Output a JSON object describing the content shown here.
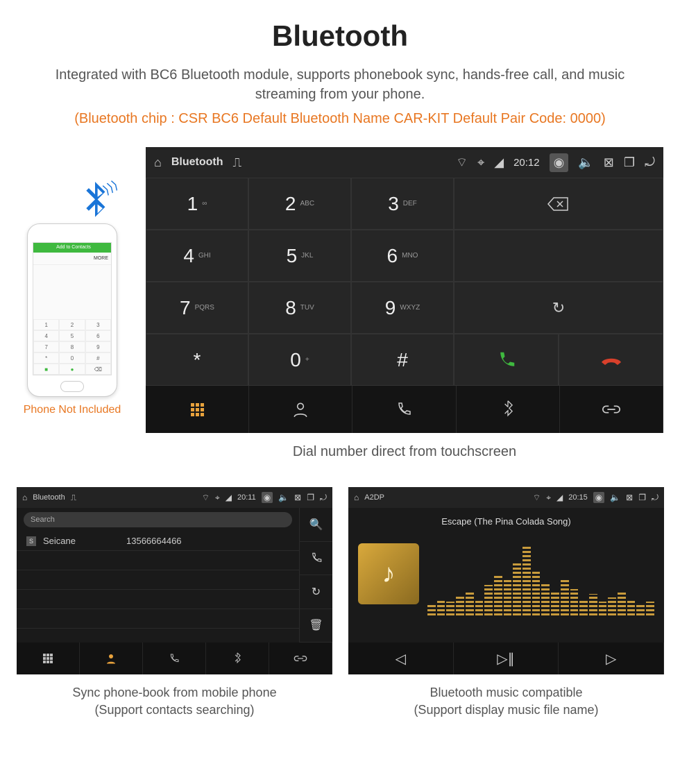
{
  "title": "Bluetooth",
  "subtitle": "Integrated with BC6 Bluetooth module, supports phonebook sync, hands-free call, and music streaming from your phone.",
  "spec": "(Bluetooth chip : CSR BC6     Default Bluetooth Name CAR-KIT     Default Pair Code: 0000)",
  "phone_caption": "Phone Not Included",
  "phone_header": "Add to Contacts",
  "phone_more": "MORE",
  "main_caption": "Dial number direct from touchscreen",
  "hu": {
    "app": "Bluetooth",
    "time": "20:12",
    "keys": [
      {
        "n": "1",
        "l": "∞"
      },
      {
        "n": "2",
        "l": "ABC"
      },
      {
        "n": "3",
        "l": "DEF"
      },
      {
        "n": "4",
        "l": "GHI"
      },
      {
        "n": "5",
        "l": "JKL"
      },
      {
        "n": "6",
        "l": "MNO"
      },
      {
        "n": "7",
        "l": "PQRS"
      },
      {
        "n": "8",
        "l": "TUV"
      },
      {
        "n": "9",
        "l": "WXYZ"
      },
      {
        "n": "*",
        "l": ""
      },
      {
        "n": "0",
        "l": "+"
      },
      {
        "n": "#",
        "l": ""
      }
    ]
  },
  "pb": {
    "app": "Bluetooth",
    "time": "20:11",
    "search": "Search",
    "badge": "S",
    "name": "Seicane",
    "number": "13566664466",
    "cap1": "Sync phone-book from mobile phone",
    "cap2": "(Support contacts searching)"
  },
  "mu": {
    "app": "A2DP",
    "time": "20:15",
    "track": "Escape (The Pina Colada Song)",
    "cap1": "Bluetooth music compatible",
    "cap2": "(Support display music file name)"
  }
}
